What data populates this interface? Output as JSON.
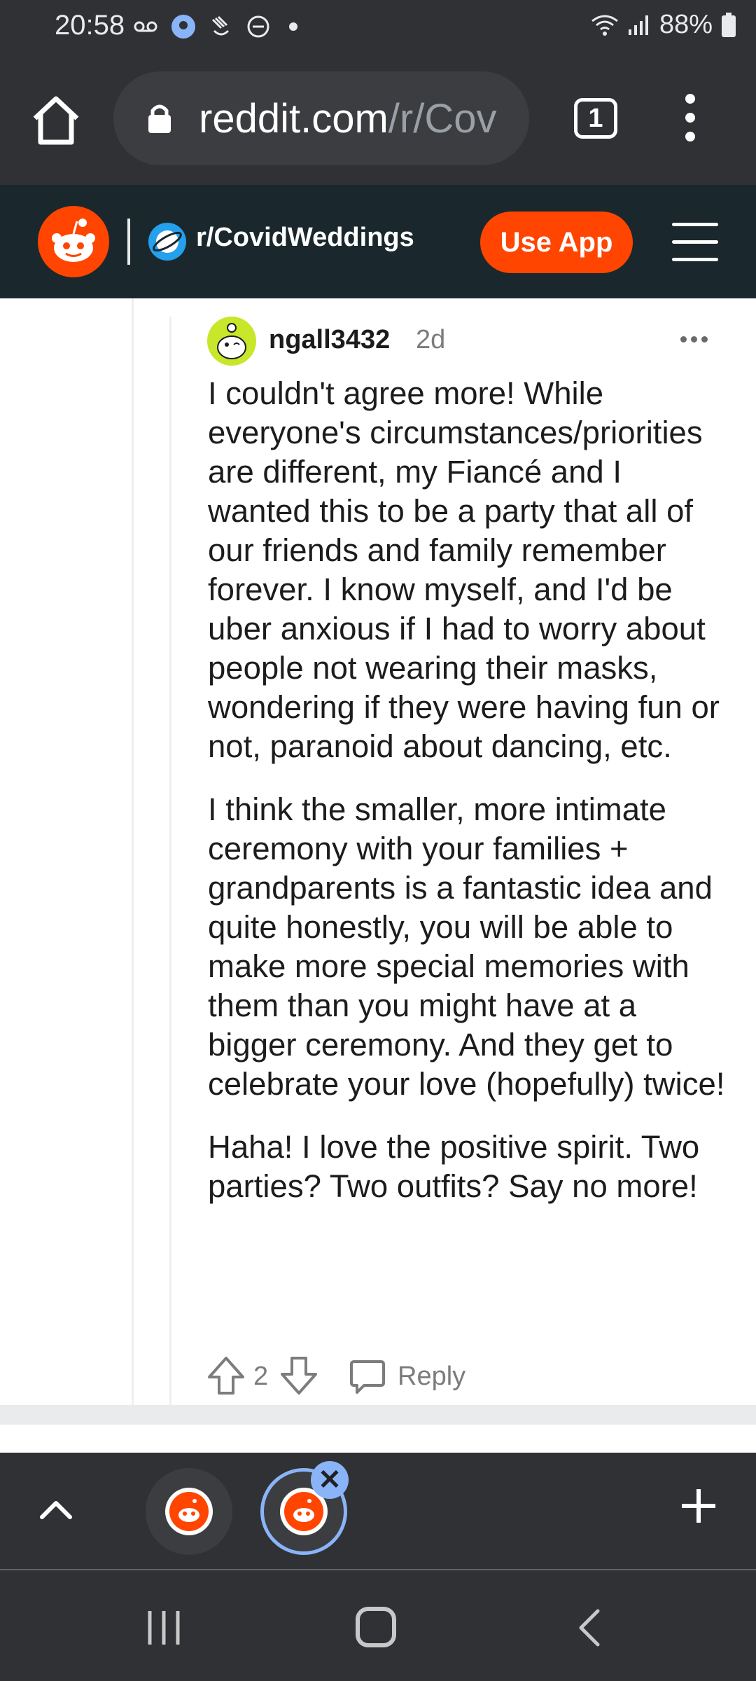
{
  "status_bar": {
    "time": "20:58",
    "battery": "88%",
    "left_icons": [
      "voicemail-icon",
      "location-icon",
      "gesture-icon",
      "dnd-icon",
      "dot-icon"
    ],
    "right_icons": [
      "wifi-icon",
      "signal-icon",
      "battery-icon"
    ]
  },
  "browser": {
    "url_domain": "reddit.com",
    "url_path": "/r/Cov",
    "tab_count": "1"
  },
  "reddit_header": {
    "subreddit": "r/CovidWeddings",
    "use_app_label": "Use App"
  },
  "comment": {
    "username": "ngall3432",
    "age": "2d",
    "paragraphs": [
      "I couldn't agree more! While everyone's circumstances/priorities are different, my Fiancé and I wanted this to be a party that all of our friends and family remember forever. I know myself, and I'd be uber anxious if I had to worry about people not wearing their masks, wondering if they were having fun or not, paranoid about dancing, etc.",
      "I think the smaller, more intimate ceremony with your families + grandparents is a fantastic idea and quite honestly, you will be able to make more special memories with them than you might have at a bigger ceremony. And they get to celebrate your love (hopefully) twice!",
      "Haha! I love the positive spirit. Two parties? Two outfits? Say no more!"
    ],
    "score": "2",
    "reply_label": "Reply"
  },
  "tab_strip": {
    "close_symbol": "✕"
  },
  "colors": {
    "chrome_dark": "#303134",
    "reddit_orange": "#ff4500",
    "reddit_header": "#1a282d",
    "tab_highlight": "#8ab4f8"
  }
}
